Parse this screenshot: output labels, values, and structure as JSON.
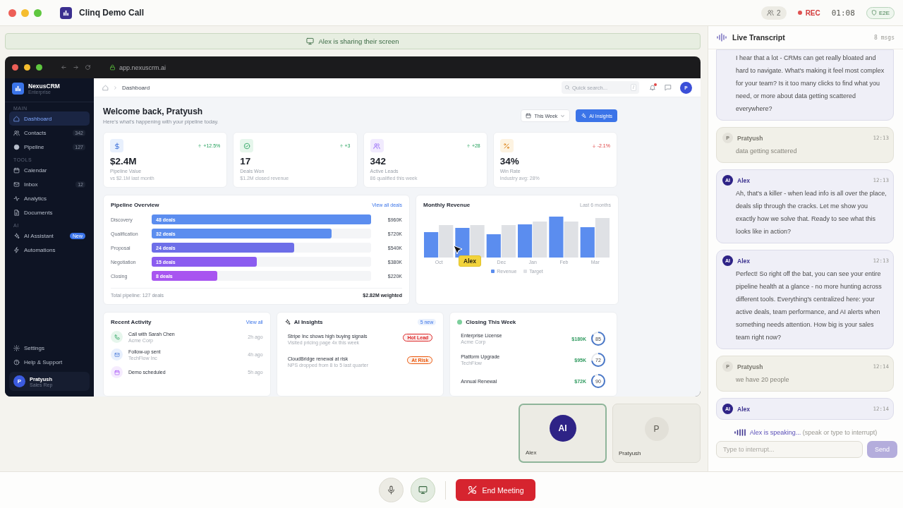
{
  "call": {
    "title": "Clinq Demo Call",
    "participants": "2",
    "recording": "REC",
    "timer": "01:08",
    "encryption": "E2E"
  },
  "share_banner": "Alex is sharing their screen",
  "browser": {
    "url": "app.nexuscrm.ai"
  },
  "crm": {
    "brand": {
      "name": "NexusCRM",
      "plan": "Enterprise"
    },
    "nav_sections": [
      {
        "title": "MAIN",
        "items": [
          {
            "label": "Dashboard",
            "selected": true
          },
          {
            "label": "Contacts",
            "count": "342",
            "selected": false
          },
          {
            "label": "Pipeline",
            "count": "127",
            "selected": false
          }
        ]
      },
      {
        "title": "TOOLS",
        "items": [
          {
            "label": "Calendar",
            "selected": false
          },
          {
            "label": "Inbox",
            "count": "12",
            "selected": false
          },
          {
            "label": "Analytics",
            "selected": false
          },
          {
            "label": "Documents",
            "selected": false
          }
        ]
      },
      {
        "title": "AI",
        "items": [
          {
            "label": "AI Assistant",
            "badge": "New",
            "selected": false
          },
          {
            "label": "Automations",
            "selected": false
          }
        ]
      }
    ],
    "footer_nav": [
      {
        "label": "Settings"
      },
      {
        "label": "Help & Support"
      }
    ],
    "user": {
      "initial": "P",
      "name": "Pratyush",
      "role": "Sales Rep"
    },
    "breadcrumb": "Dashboard",
    "search": {
      "placeholder": "Quick search...",
      "shortcut": "/"
    },
    "notifications_unread": true,
    "avatar_initial": "P",
    "welcome": {
      "title": "Welcome back, Pratyush",
      "subtitle": "Here's what's happening with your pipeline today."
    },
    "period": "This Week",
    "ai_button": "AI Insights",
    "stats": [
      {
        "value": "$2.4M",
        "label": "Pipeline Value",
        "note": "vs $2.1M last month",
        "change": "+12.5%",
        "negative": false
      },
      {
        "value": "17",
        "label": "Deals Won",
        "note": "$1.2M closed revenue",
        "change": "+3",
        "negative": false
      },
      {
        "value": "342",
        "label": "Active Leads",
        "note": "86 qualified this week",
        "change": "+28",
        "negative": false
      },
      {
        "value": "34%",
        "label": "Win Rate",
        "note": "Industry avg: 28%",
        "change": "-2.1%",
        "negative": true
      }
    ],
    "pipeline": {
      "title": "Pipeline Overview",
      "link": "View all deals",
      "stages": [
        {
          "name": "Discovery",
          "deals": "48 deals",
          "value": "$960K",
          "level": 1.0,
          "color": "#5b8def"
        },
        {
          "name": "Qualification",
          "deals": "32 deals",
          "value": "$720K",
          "level": 0.82,
          "color": "#5b8def"
        },
        {
          "name": "Proposal",
          "deals": "24 deals",
          "value": "$540K",
          "level": 0.65,
          "color": "#6d6ee8"
        },
        {
          "name": "Negotiation",
          "deals": "15 deals",
          "value": "$380K",
          "level": 0.48,
          "color": "#8b5cf0"
        },
        {
          "name": "Closing",
          "deals": "8 deals",
          "value": "$220K",
          "level": 0.3,
          "color": "#a855f0"
        }
      ],
      "total": "Total pipeline: 127 deals",
      "weighted": "$2.82M weighted"
    },
    "revenue": {
      "title": "Monthly Revenue",
      "range": "Last 6 months",
      "months": [
        {
          "label": "Oct"
        },
        {
          "label": "Dec"
        },
        {
          "label": "Jan"
        },
        {
          "label": "Feb"
        },
        {
          "label": "Mar"
        }
      ],
      "legend": [
        {
          "label": "Revenue",
          "color": "#5b8def"
        },
        {
          "label": "Target",
          "color": "#dfe1e5"
        }
      ]
    },
    "activity": {
      "title": "Recent Activity",
      "link": "View all",
      "items": [
        {
          "title": "Call with Sarah Chen",
          "sub": "Acme Corp",
          "time": "2h ago"
        },
        {
          "title": "Follow-up sent",
          "sub": "TechFlow Inc",
          "time": "4h ago"
        },
        {
          "title": "Demo scheduled",
          "time": "5h ago"
        }
      ]
    },
    "insights": {
      "title": "AI Insights",
      "badge": "5 new",
      "items": [
        {
          "title": "Stripe Inc shows high buying signals",
          "sub": "Visited pricing page 4x this week",
          "tag": "Hot Lead",
          "color": "#dc2626"
        },
        {
          "title": "CloudBridge renewal at risk",
          "sub": "NPS dropped from 8 to 5 last quarter",
          "tag": "At Risk",
          "color": "#ea580c"
        }
      ]
    },
    "closing": {
      "title": "Closing This Week",
      "items": [
        {
          "name": "Enterprise License",
          "company": "Acme Corp",
          "amount": "$180K",
          "score": "85"
        },
        {
          "name": "Platform Upgrade",
          "company": "TechFlow",
          "amount": "$95K",
          "score": "72"
        },
        {
          "name": "Annual Renewal",
          "amount": "$72K",
          "score": "90"
        }
      ]
    }
  },
  "cursor": {
    "label": "Alex"
  },
  "tiles": [
    {
      "initials": "AI",
      "name": "Alex",
      "kind": "ai",
      "speaking": true
    },
    {
      "initials": "P",
      "name": "Pratyush",
      "kind": "user",
      "speaking": false
    }
  ],
  "transcript": {
    "title": "Live Transcript",
    "count": "8 msgs",
    "messages": [
      {
        "kind": "ai",
        "text": "I hear that a lot - CRMs can get really bloated and hard to navigate. What's making it feel most complex for your team? Is it too many clicks to find what you need, or more about data getting scattered everywhere?"
      },
      {
        "kind": "user",
        "initial": "P",
        "speaker": "Pratyush",
        "time": "12:13",
        "text": "data getting scattered"
      },
      {
        "kind": "ai",
        "initial": "AI",
        "speaker": "Alex",
        "time": "12:13",
        "text": "Ah, that's a killer - when lead info is all over the place, deals slip through the cracks. Let me show you exactly how we solve that. Ready to see what this looks like in action?"
      },
      {
        "kind": "ai",
        "initial": "AI",
        "speaker": "Alex",
        "time": "12:13",
        "text": "Perfect! So right off the bat, you can see your entire pipeline health at a glance - no more hunting across different tools. Everything's centralized here: your active deals, team performance, and AI alerts when something needs attention. How big is your sales team right now?"
      },
      {
        "kind": "user",
        "initial": "P",
        "speaker": "Pratyush",
        "time": "12:14",
        "text": "we have 20 people"
      },
      {
        "kind": "ai",
        "initial": "AI",
        "speaker": "Alex",
        "time": "12:14"
      }
    ],
    "speaking": "Alex is speaking...",
    "hint": "(speak or type to interrupt)",
    "placeholder": "Type to interrupt...",
    "send": "Send",
    "send_disabled": true
  },
  "controls": [
    {
      "kind": "mic",
      "active": false
    },
    {
      "kind": "screen",
      "active": true
    }
  ],
  "end_button": "End Meeting"
}
